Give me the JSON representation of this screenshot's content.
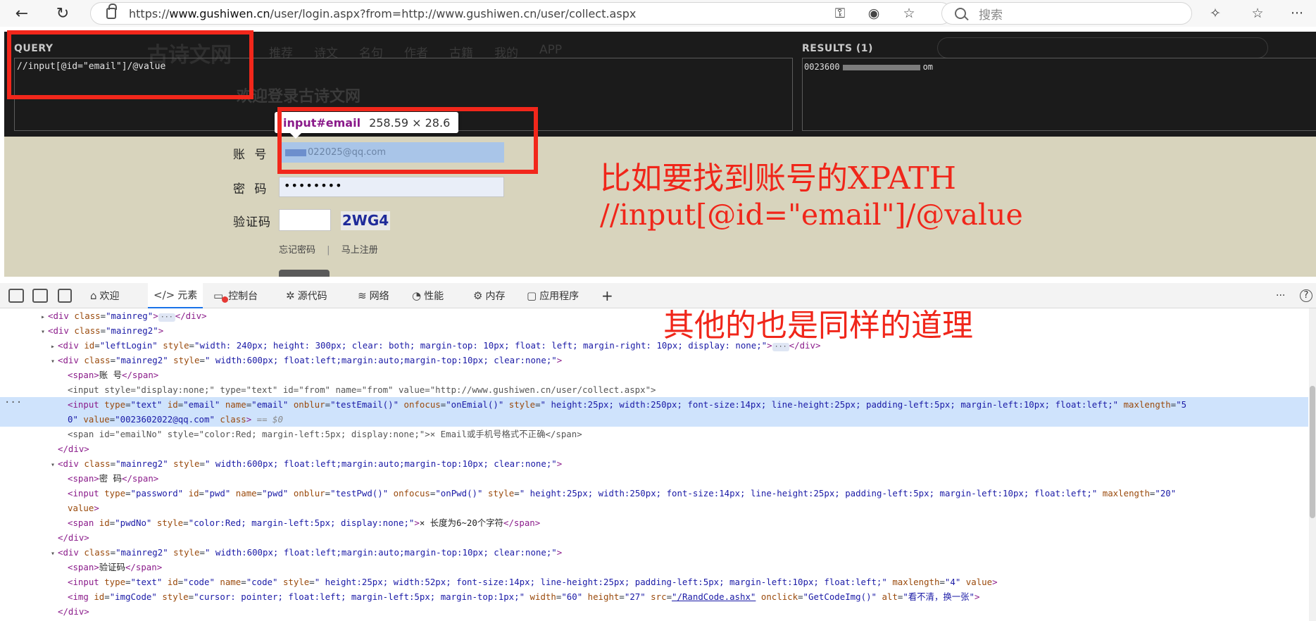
{
  "browser": {
    "url_prefix": "https://",
    "url_host": "www.gushiwen.cn",
    "url_path": "/user/login.aspx?from=http://www.gushiwen.cn/user/collect.aspx",
    "search_placeholder": "搜索"
  },
  "page": {
    "site_logo": "古诗文网",
    "nav_items": [
      "推荐",
      "诗文",
      "名句",
      "作者",
      "古籍",
      "我的",
      "APP"
    ],
    "heading": "欢迎登录古诗文网",
    "query_label": "QUERY",
    "query_value": "//input[@id=\"email\"]/@value",
    "results_label": "RESULTS (1)",
    "result_prefix": "0023600",
    "result_suffix": "om",
    "tooltip_selector": "input#email",
    "tooltip_size": "258.59 × 28.6",
    "form": {
      "account_label": "账 号",
      "account_value": "022025@qq.com",
      "password_label": "密 码",
      "password_value": "••••••••",
      "code_label": "验证码",
      "captcha_text": "2WG4",
      "forgot_link": "忘记密码",
      "link_separator": "|",
      "register_link": "马上注册"
    }
  },
  "annotations": {
    "line1": "比如要找到账号的XPATH",
    "line2": "//input[@id=\"email\"]/@value",
    "line3": "其他的也是同样的道理"
  },
  "devtools": {
    "tabs": [
      {
        "name": "welcome",
        "glyph": "⌂",
        "label": "欢迎"
      },
      {
        "name": "elements",
        "glyph": "</>",
        "label": "元素"
      },
      {
        "name": "console",
        "glyph": "▭",
        "label": "控制台"
      },
      {
        "name": "sources",
        "glyph": "✲",
        "label": "源代码"
      },
      {
        "name": "network",
        "glyph": "≋",
        "label": "网络"
      },
      {
        "name": "performance",
        "glyph": "◔",
        "label": "性能"
      },
      {
        "name": "memory",
        "glyph": "⚙",
        "label": "内存"
      },
      {
        "name": "application",
        "glyph": "▢",
        "label": "应用程序"
      }
    ],
    "add_tab": "+",
    "more": "···",
    "help": "?"
  },
  "code": {
    "l1": {
      "open": "<div ",
      "a1": "class",
      "v1": "\"mainreg\"",
      "close": ">",
      "end": "</div>"
    },
    "l2": {
      "open": "<div ",
      "a1": "class",
      "v1": "\"mainreg2\"",
      "close": ">"
    },
    "l3": {
      "open": "<div ",
      "a1": "id",
      "v1": "\"leftLogin\"",
      "a2": "style",
      "v2": "\"width: 240px; height: 300px; clear: both; margin-top: 10px; float: left; margin-right: 10px; display: none;\"",
      "close": ">",
      "end": "</div>"
    },
    "l4": {
      "open": "<div ",
      "a1": "class",
      "v1": "\"mainreg2\"",
      "a2": "style",
      "v2": "\" width:600px; float:left;margin:auto;margin-top:10px; clear:none;\"",
      "close": ">"
    },
    "l5": {
      "open": "<span>",
      "text": "账 号",
      "close": "</span>"
    },
    "l6": {
      "text": "<input style=\"display:none;\" type=\"text\" id=\"from\" name=\"from\" value=\"http://www.gushiwen.cn/user/collect.aspx\">"
    },
    "l7": {
      "open": "<input ",
      "a1": "type",
      "v1": "\"text\"",
      "a2": "id",
      "v2": "\"email\"",
      "a3": "name",
      "v3": "\"email\"",
      "a4": "onblur",
      "v4": "\"testEmail()\"",
      "a5": "onfocus",
      "v5": "\"onEmial()\"",
      "a6": "style",
      "v6": "\" height:25px; width:250px; font-size:14px; line-height:25px; padding-left:5px; margin-left:10px; float:left;\"",
      "a7": "maxlength",
      "v7": "\"5"
    },
    "l8": {
      "v7b": "0\"",
      "a8": "value",
      "v8": "\"0023602022@qq.com\"",
      "a9": "class",
      "close": ">",
      "marker": "== $0"
    },
    "l9": {
      "text": "<span id=\"emailNo\" style=\"color:Red; margin-left:5px; display:none;\">× Email或手机号格式不正确</span>"
    },
    "l10": {
      "text": "</div>"
    },
    "l11": {
      "open": "<div ",
      "a1": "class",
      "v1": "\"mainreg2\"",
      "a2": "style",
      "v2": "\" width:600px; float:left;margin:auto;margin-top:10px; clear:none;\"",
      "close": ">"
    },
    "l12": {
      "open": "<span>",
      "text": "密 码",
      "close": "</span>"
    },
    "l13": {
      "open": "<input ",
      "a1": "type",
      "v1": "\"password\"",
      "a2": "id",
      "v2": "\"pwd\"",
      "a3": "name",
      "v3": "\"pwd\"",
      "a4": "onblur",
      "v4": "\"testPwd()\"",
      "a5": "onfocus",
      "v5": "\"onPwd()\"",
      "a6": "style",
      "v6": "\" height:25px; width:250px; font-size:14px; line-height:25px; padding-left:5px; margin-left:10px; float:left;\"",
      "a7": "maxlength",
      "v7": "\"20\""
    },
    "l14": {
      "a1": "value",
      "close": ">"
    },
    "l15": {
      "open": "<span ",
      "a1": "id",
      "v1": "\"pwdNo\"",
      "a2": "style",
      "v2": "\"color:Red; margin-left:5px; display:none;\"",
      "close": ">",
      "text": "× 长度为6~20个字符",
      "end": "</span>"
    },
    "l16": {
      "text": "</div>"
    },
    "l17": {
      "open": "<div ",
      "a1": "class",
      "v1": "\"mainreg2\"",
      "a2": "style",
      "v2": "\" width:600px; float:left;margin:auto;margin-top:10px; clear:none;\"",
      "close": ">"
    },
    "l18": {
      "open": "<span>",
      "text": "验证码",
      "close": "</span>"
    },
    "l19": {
      "open": "<input ",
      "a1": "type",
      "v1": "\"text\"",
      "a2": "id",
      "v2": "\"code\"",
      "a3": "name",
      "v3": "\"code\"",
      "a4": "style",
      "v4": "\" height:25px; width:52px; font-size:14px; line-height:25px; padding-left:5px; margin-left:10px; float:left;\"",
      "a5": "maxlength",
      "v5": "\"4\"",
      "a6": "value",
      "close": ">"
    },
    "l20": {
      "open": "<img ",
      "a1": "id",
      "v1": "\"imgCode\"",
      "a2": "style",
      "v2": "\"cursor: pointer; float:left; margin-left:5px; margin-top:1px;\"",
      "a3": "width",
      "v3": "\"60\"",
      "a4": "height",
      "v4": "\"27\"",
      "a5": "src",
      "v5": "\"/RandCode.ashx\"",
      "a6": "onclick",
      "v6": "\"GetCodeImg()\"",
      "a7": "alt",
      "v7": "\"看不清，换一张\"",
      "close": ">"
    },
    "l21": {
      "text": "</div>"
    }
  },
  "colors": {
    "annotation_red": "#f2271b",
    "selection_blue": "#cfe3fc",
    "tag_purple": "#8b1c8b"
  }
}
